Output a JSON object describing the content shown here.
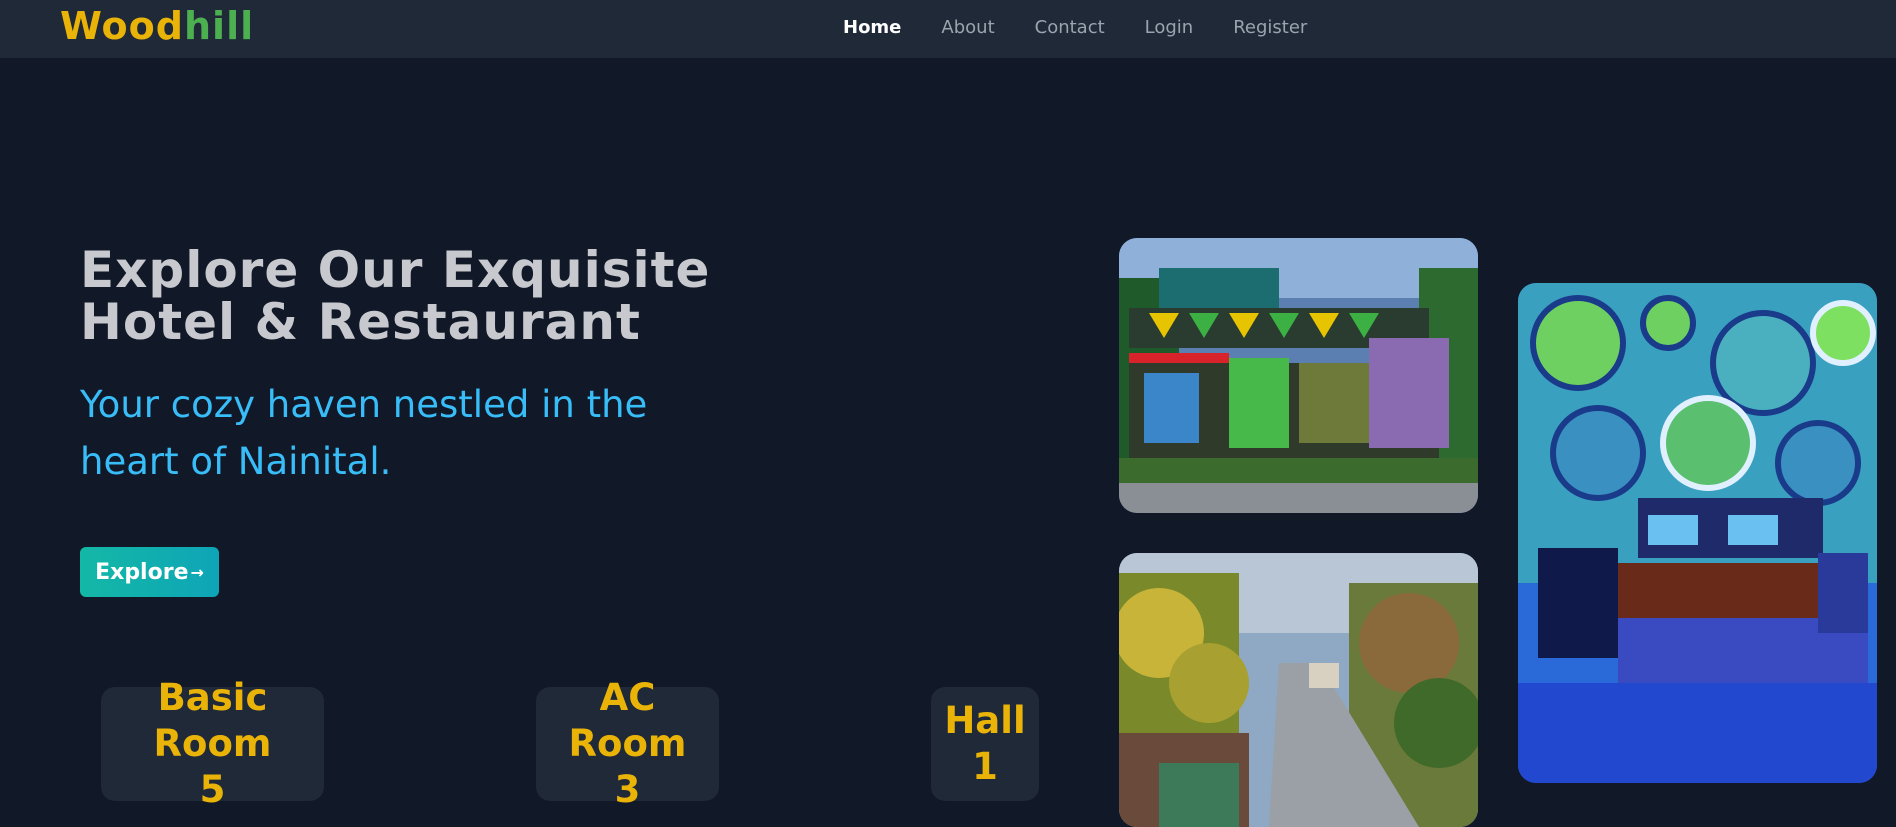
{
  "brand": {
    "part1": "Wood",
    "part2": "hill"
  },
  "nav": {
    "items": [
      "Home",
      "About",
      "Contact",
      "Login",
      "Register"
    ],
    "active": "Home"
  },
  "hero": {
    "title": "Explore Our Exquisite Hotel & Restaurant",
    "subtitle": "Your cozy haven nestled in the heart of Nainital.",
    "button_label": "Explore",
    "button_icon": "arrow-right-icon"
  },
  "stats": [
    {
      "name": "Basic Room",
      "count": "5"
    },
    {
      "name": "AC Room",
      "count": "3"
    },
    {
      "name": "Hall",
      "count": "1"
    }
  ],
  "images": [
    {
      "name": "hotel-exterior-photo"
    },
    {
      "name": "mountain-road-photo"
    },
    {
      "name": "room-interior-photo"
    }
  ],
  "colors": {
    "background": "#111827",
    "navbar": "#1f2937",
    "accent_yellow": "#eab308",
    "accent_green": "#4caf50",
    "subtitle_blue": "#38bdf8",
    "button_teal": "#14b8a6"
  }
}
